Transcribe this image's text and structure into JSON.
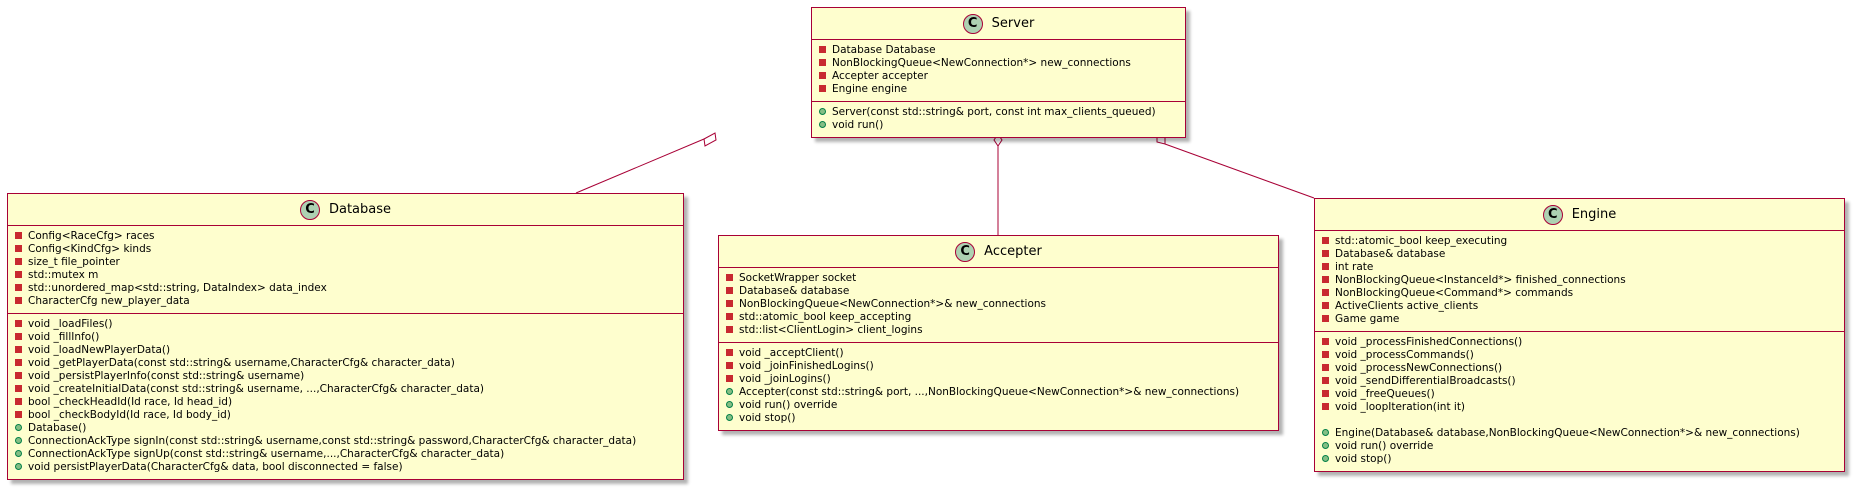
{
  "colors": {
    "class_fill": "#FEFECE",
    "class_border": "#A80036",
    "class_badge": "#ADD1B2",
    "private_marker": "#C82930",
    "public_marker": "#84BE84"
  },
  "classes": {
    "server": {
      "badge": "C",
      "name": "Server",
      "fields": [
        {
          "vis": "private",
          "text": "Database Database"
        },
        {
          "vis": "private",
          "text": "NonBlockingQueue<NewConnection*> new_connections"
        },
        {
          "vis": "private",
          "text": "Accepter accepter"
        },
        {
          "vis": "private",
          "text": "Engine engine"
        }
      ],
      "methods": [
        {
          "vis": "public",
          "text": "Server(const std::string& port, const int max_clients_queued)"
        },
        {
          "vis": "public",
          "text": "void run()"
        }
      ]
    },
    "database": {
      "badge": "C",
      "name": "Database",
      "fields": [
        {
          "vis": "private",
          "text": "Config<RaceCfg> races"
        },
        {
          "vis": "private",
          "text": "Config<KindCfg> kinds"
        },
        {
          "vis": "private",
          "text": "size_t file_pointer"
        },
        {
          "vis": "private",
          "text": "std::mutex m"
        },
        {
          "vis": "private",
          "text": "std::unordered_map<std::string, DataIndex> data_index"
        },
        {
          "vis": "private",
          "text": "CharacterCfg new_player_data"
        }
      ],
      "methods": [
        {
          "vis": "private",
          "text": "void _loadFiles()"
        },
        {
          "vis": "private",
          "text": "void _fillInfo()"
        },
        {
          "vis": "private",
          "text": "void _loadNewPlayerData()"
        },
        {
          "vis": "private",
          "text": "void _getPlayerData(const std::string& username,CharacterCfg& character_data)"
        },
        {
          "vis": "private",
          "text": "void _persistPlayerInfo(const std::string& username)"
        },
        {
          "vis": "private",
          "text": "void _createInitialData(const std::string& username, ...,CharacterCfg& character_data)"
        },
        {
          "vis": "private",
          "text": "bool _checkHeadId(Id race, Id head_id)"
        },
        {
          "vis": "private",
          "text": "bool _checkBodyId(Id race, Id body_id)"
        },
        {
          "vis": "public",
          "text": "Database()"
        },
        {
          "vis": "public",
          "text": "ConnectionAckType signIn(const std::string& username,const std::string& password,CharacterCfg& character_data)"
        },
        {
          "vis": "public",
          "text": "ConnectionAckType signUp(const std::string& username,...,CharacterCfg& character_data)"
        },
        {
          "vis": "public",
          "text": "void persistPlayerData(CharacterCfg& data, bool disconnected = false)"
        }
      ]
    },
    "accepter": {
      "badge": "C",
      "name": "Accepter",
      "fields": [
        {
          "vis": "private",
          "text": "SocketWrapper socket"
        },
        {
          "vis": "private",
          "text": "Database& database"
        },
        {
          "vis": "private",
          "text": "NonBlockingQueue<NewConnection*>& new_connections"
        },
        {
          "vis": "private",
          "text": "std::atomic_bool keep_accepting"
        },
        {
          "vis": "private",
          "text": "std::list<ClientLogin> client_logins"
        }
      ],
      "methods": [
        {
          "vis": "private",
          "text": "void _acceptClient()"
        },
        {
          "vis": "private",
          "text": "void _joinFinishedLogins()"
        },
        {
          "vis": "private",
          "text": "void _joinLogins()"
        },
        {
          "vis": "public",
          "text": "Accepter(const std::string& port, ...,NonBlockingQueue<NewConnection*>& new_connections)"
        },
        {
          "vis": "public",
          "text": "void run() override"
        },
        {
          "vis": "public",
          "text": "void stop()"
        }
      ]
    },
    "engine": {
      "badge": "C",
      "name": "Engine",
      "fields": [
        {
          "vis": "private",
          "text": "std::atomic_bool keep_executing"
        },
        {
          "vis": "private",
          "text": "Database& database"
        },
        {
          "vis": "private",
          "text": "int rate"
        },
        {
          "vis": "private",
          "text": "NonBlockingQueue<InstanceId*> finished_connections"
        },
        {
          "vis": "private",
          "text": "NonBlockingQueue<Command*> commands"
        },
        {
          "vis": "private",
          "text": "ActiveClients active_clients"
        },
        {
          "vis": "private",
          "text": "Game game"
        }
      ],
      "methods": [
        {
          "vis": "private",
          "text": "void _processFinishedConnections()"
        },
        {
          "vis": "private",
          "text": "void _processCommands()"
        },
        {
          "vis": "private",
          "text": "void _processNewConnections()"
        },
        {
          "vis": "private",
          "text": "void _sendDifferentialBroadcasts()"
        },
        {
          "vis": "private",
          "text": "void _freeQueues()"
        },
        {
          "vis": "private",
          "text": "void _loopIteration(int it)"
        },
        {
          "vis": "gap",
          "text": ""
        },
        {
          "vis": "public",
          "text": "Engine(Database& database,NonBlockingQueue<NewConnection*>& new_connections)"
        },
        {
          "vis": "public",
          "text": "void run() override"
        },
        {
          "vis": "public",
          "text": "void stop()"
        }
      ]
    }
  },
  "relations": [
    {
      "from": "server",
      "to": "database",
      "type": "aggregation"
    },
    {
      "from": "server",
      "to": "accepter",
      "type": "aggregation"
    },
    {
      "from": "server",
      "to": "engine",
      "type": "aggregation"
    }
  ]
}
